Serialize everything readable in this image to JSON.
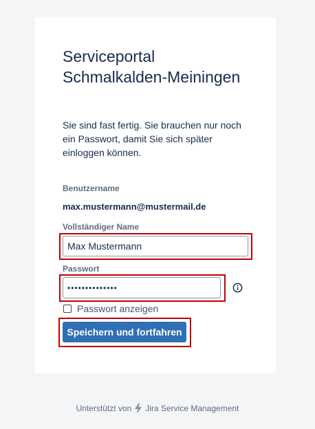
{
  "card": {
    "title": "Serviceportal Schmalkalden-Meiningen",
    "description": "Sie sind fast fertig. Sie brauchen nur noch ein Passwort, damit Sie sich später einloggen können."
  },
  "form": {
    "username_label": "Benutzername",
    "username_value": "max.mustermann@mustermail.de",
    "fullname_label": "Vollständiger Name",
    "fullname_value": "Max Mustermann",
    "password_label": "Passwort",
    "password_value": "••••••••••••••",
    "show_password_label": "Passwort anzeigen",
    "show_password_checked": false,
    "submit_label": "Speichern und fortfahren"
  },
  "footer": {
    "prefix": "Unterstützt von",
    "product": "Jira Service Management"
  },
  "colors": {
    "button": "#2f6fb4",
    "highlight": "#c00000",
    "text": "#172b4d"
  },
  "icons": [
    "info-icon",
    "jira-bolt-icon"
  ]
}
